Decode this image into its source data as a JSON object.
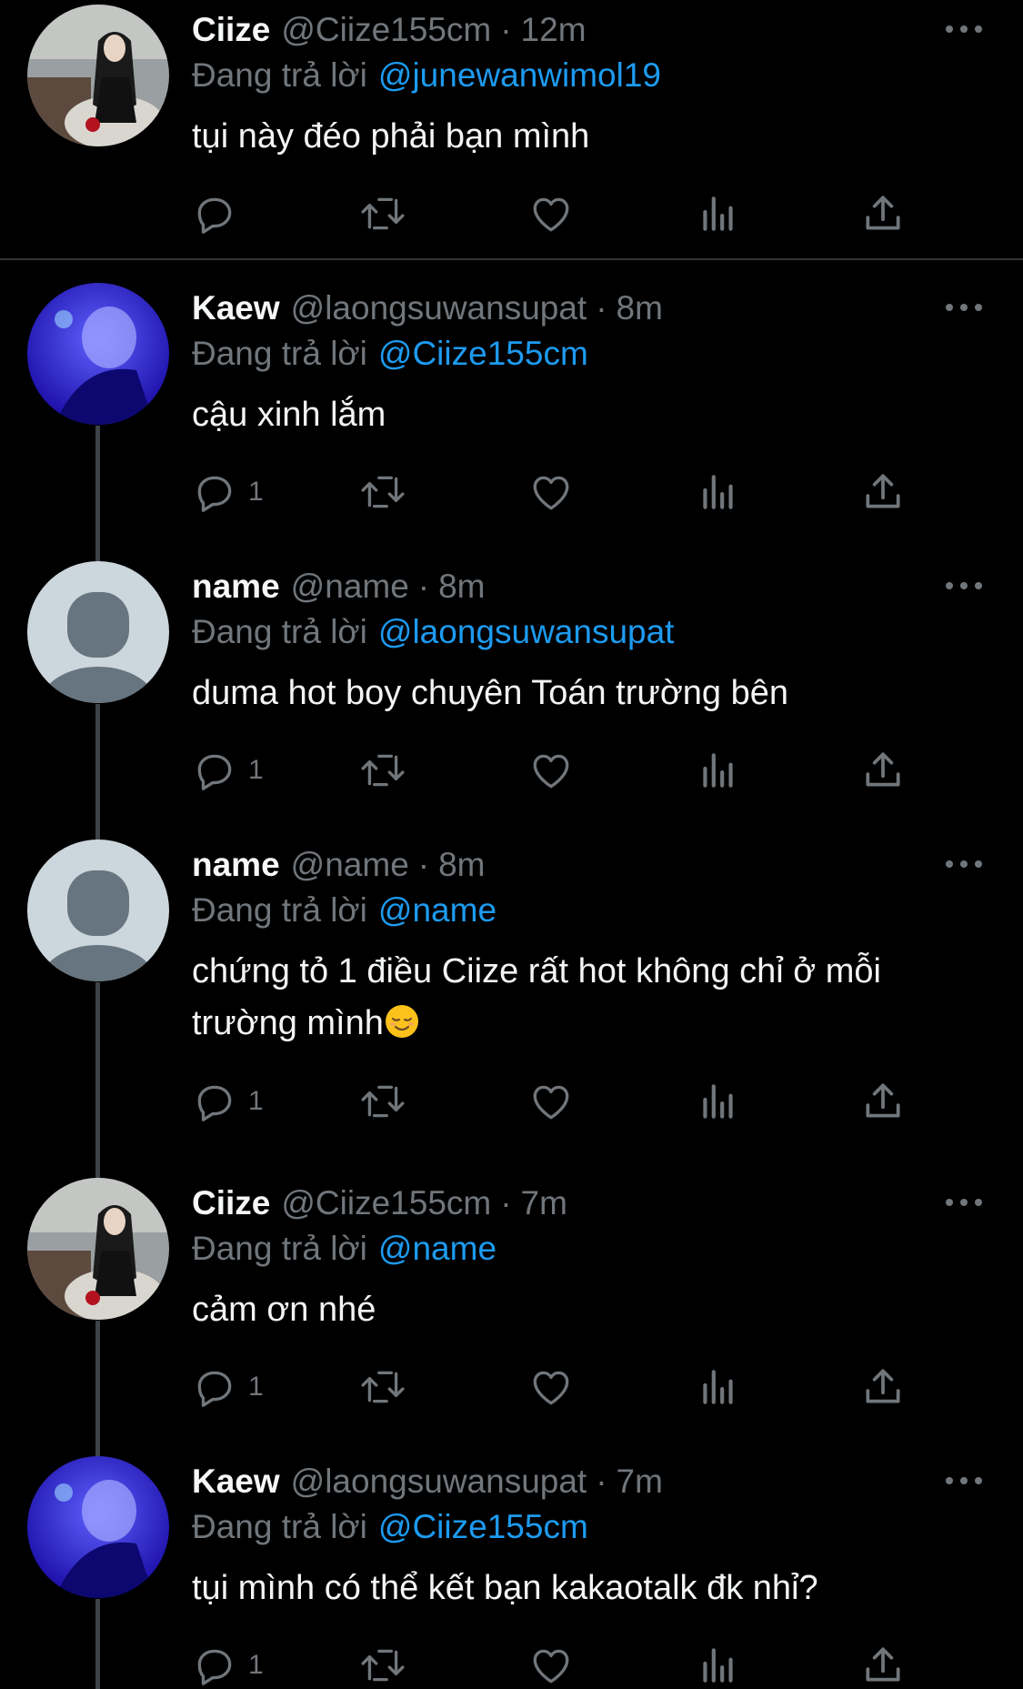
{
  "tweets": [
    {
      "name": "Ciize",
      "handle": "@Ciize155cm",
      "time": "12m",
      "reply_label": "Đang trả lời",
      "reply_to": "@junewanwimol19",
      "text": "tụi này đéo phải bạn mình",
      "reply_count": "",
      "avatar": "photo-woman"
    },
    {
      "name": "Kaew",
      "handle": "@laongsuwansupat",
      "time": "8m",
      "reply_label": "Đang trả lời",
      "reply_to": "@Ciize155cm",
      "text": "cậu xinh lắm",
      "reply_count": "1",
      "avatar": "photo-blue"
    },
    {
      "name": "name",
      "handle": "@name",
      "time": "8m",
      "reply_label": "Đang trả lời",
      "reply_to": "@laongsuwansupat",
      "text": "duma hot boy chuyên Toán trường bên",
      "reply_count": "1",
      "avatar": "default"
    },
    {
      "name": "name",
      "handle": "@name",
      "time": "8m",
      "reply_label": "Đang trả lời",
      "reply_to": "@name",
      "text": "chứng tỏ 1 điều Ciize rất hot không chỉ ở mỗi",
      "text_line2": "trường mình",
      "emoji": "relieved-face-emoji",
      "reply_count": "1",
      "avatar": "default"
    },
    {
      "name": "Ciize",
      "handle": "@Ciize155cm",
      "time": "7m",
      "reply_label": "Đang trả lời",
      "reply_to": "@name",
      "text": "cảm ơn nhé",
      "reply_count": "1",
      "avatar": "photo-woman"
    },
    {
      "name": "Kaew",
      "handle": "@laongsuwansupat",
      "time": "7m",
      "reply_label": "Đang trả lời",
      "reply_to": "@Ciize155cm",
      "text": "tụi mình có thể kết bạn kakaotalk đk nhỉ?",
      "reply_count": "1",
      "avatar": "photo-blue"
    }
  ],
  "colors": {
    "background": "#000000",
    "link": "#1d9bf0",
    "muted": "#71767b",
    "divider": "#2f3336",
    "thread_line": "#3d4348"
  },
  "icons": [
    "reply-icon",
    "retweet-icon",
    "like-icon",
    "views-icon",
    "share-icon",
    "more-icon"
  ]
}
